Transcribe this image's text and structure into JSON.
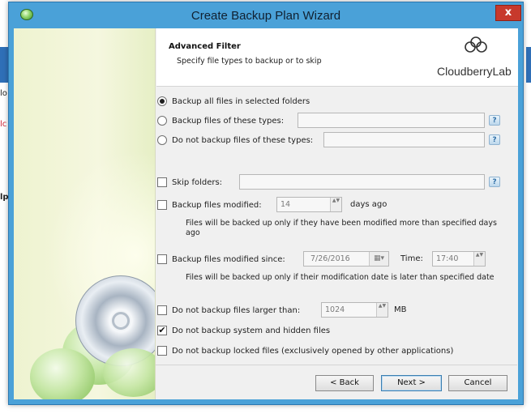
{
  "window": {
    "title": "Create Backup Plan Wizard",
    "close_glyph": "x",
    "icon": "app-cloud-icon"
  },
  "background": {
    "frag_1": "lo",
    "frag_2": "lc",
    "frag_3": "lp"
  },
  "header": {
    "title": "Advanced Filter",
    "subtitle": "Specify file types to backup or to skip",
    "logo_text": "CloudberryLab"
  },
  "filter": {
    "all_files_label": "Backup all files in selected folders",
    "these_types_label": "Backup files of these types:",
    "not_these_types_label": "Do not backup files of these types:",
    "selected": "all_files"
  },
  "options": {
    "skip_folders_label": "Skip folders:",
    "modified_label": "Backup files modified:",
    "modified_days": "14",
    "modified_unit": "days ago",
    "modified_note": "Files will be backed up only if they have been modified more than specified days ago",
    "modified_since_label": "Backup files modified since:",
    "since_date": "7/26/2016",
    "time_label": "Time:",
    "since_time": "17:40",
    "since_note": "Files will be backed up only if their modification date is later than specified date",
    "larger_label": "Do not backup files larger than:",
    "larger_value": "1024",
    "larger_unit": "MB",
    "system_hidden_label": "Do not backup system and hidden files",
    "system_hidden_checked": true,
    "locked_label": "Do not backup locked files (exclusively opened by other applications)"
  },
  "glyphs": {
    "help": "?",
    "check": "✔",
    "spin": "▲▼",
    "calendar": "▦▾"
  },
  "buttons": {
    "back": "< Back",
    "next": "Next >",
    "cancel": "Cancel"
  }
}
